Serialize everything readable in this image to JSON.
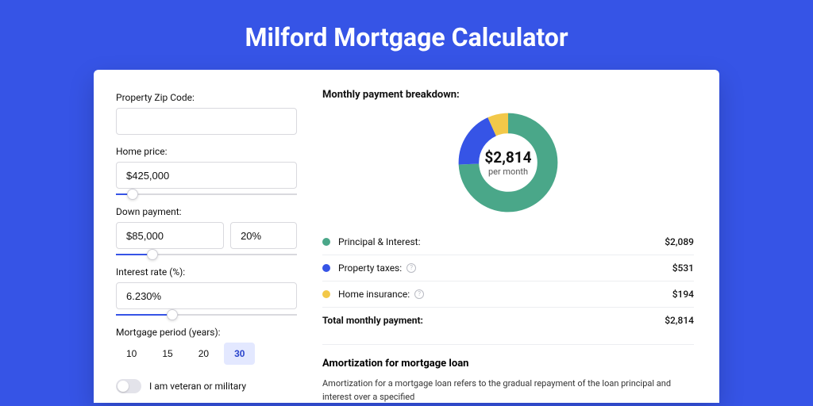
{
  "page_title": "Milford Mortgage Calculator",
  "colors": {
    "principal": "#4aa789",
    "taxes": "#3654e6",
    "insurance": "#f2c849"
  },
  "form": {
    "zip_label": "Property Zip Code:",
    "zip_value": "",
    "home_price_label": "Home price:",
    "home_price_value": "$425,000",
    "home_price_slider_pct": 9,
    "down_payment_label": "Down payment:",
    "down_payment_value": "$85,000",
    "down_payment_pct": "20%",
    "down_payment_slider_pct": 20,
    "rate_label": "Interest rate (%):",
    "rate_value": "6.230%",
    "rate_slider_pct": 31,
    "period_label": "Mortgage period (years):",
    "periods": [
      "10",
      "15",
      "20",
      "30"
    ],
    "period_active": "30",
    "veteran_label": "I am veteran or military"
  },
  "breakdown": {
    "title": "Monthly payment breakdown:",
    "center_value": "$2,814",
    "center_sub": "per month",
    "rows": [
      {
        "label": "Principal & Interest:",
        "amount": "$2,089",
        "swatch": "#4aa789",
        "help": false
      },
      {
        "label": "Property taxes:",
        "amount": "$531",
        "swatch": "#3654e6",
        "help": true
      },
      {
        "label": "Home insurance:",
        "amount": "$194",
        "swatch": "#f2c849",
        "help": true
      }
    ],
    "total_label": "Total monthly payment:",
    "total_amount": "$2,814"
  },
  "amort": {
    "title": "Amortization for mortgage loan",
    "text": "Amortization for a mortgage loan refers to the gradual repayment of the loan principal and interest over a specified"
  },
  "chart_data": {
    "type": "pie",
    "title": "Monthly payment breakdown",
    "categories": [
      "Principal & Interest",
      "Property taxes",
      "Home insurance"
    ],
    "values": [
      2089,
      531,
      194
    ],
    "colors": [
      "#4aa789",
      "#3654e6",
      "#f2c849"
    ],
    "center": {
      "value": "$2,814",
      "sub": "per month"
    },
    "total": 2814
  }
}
